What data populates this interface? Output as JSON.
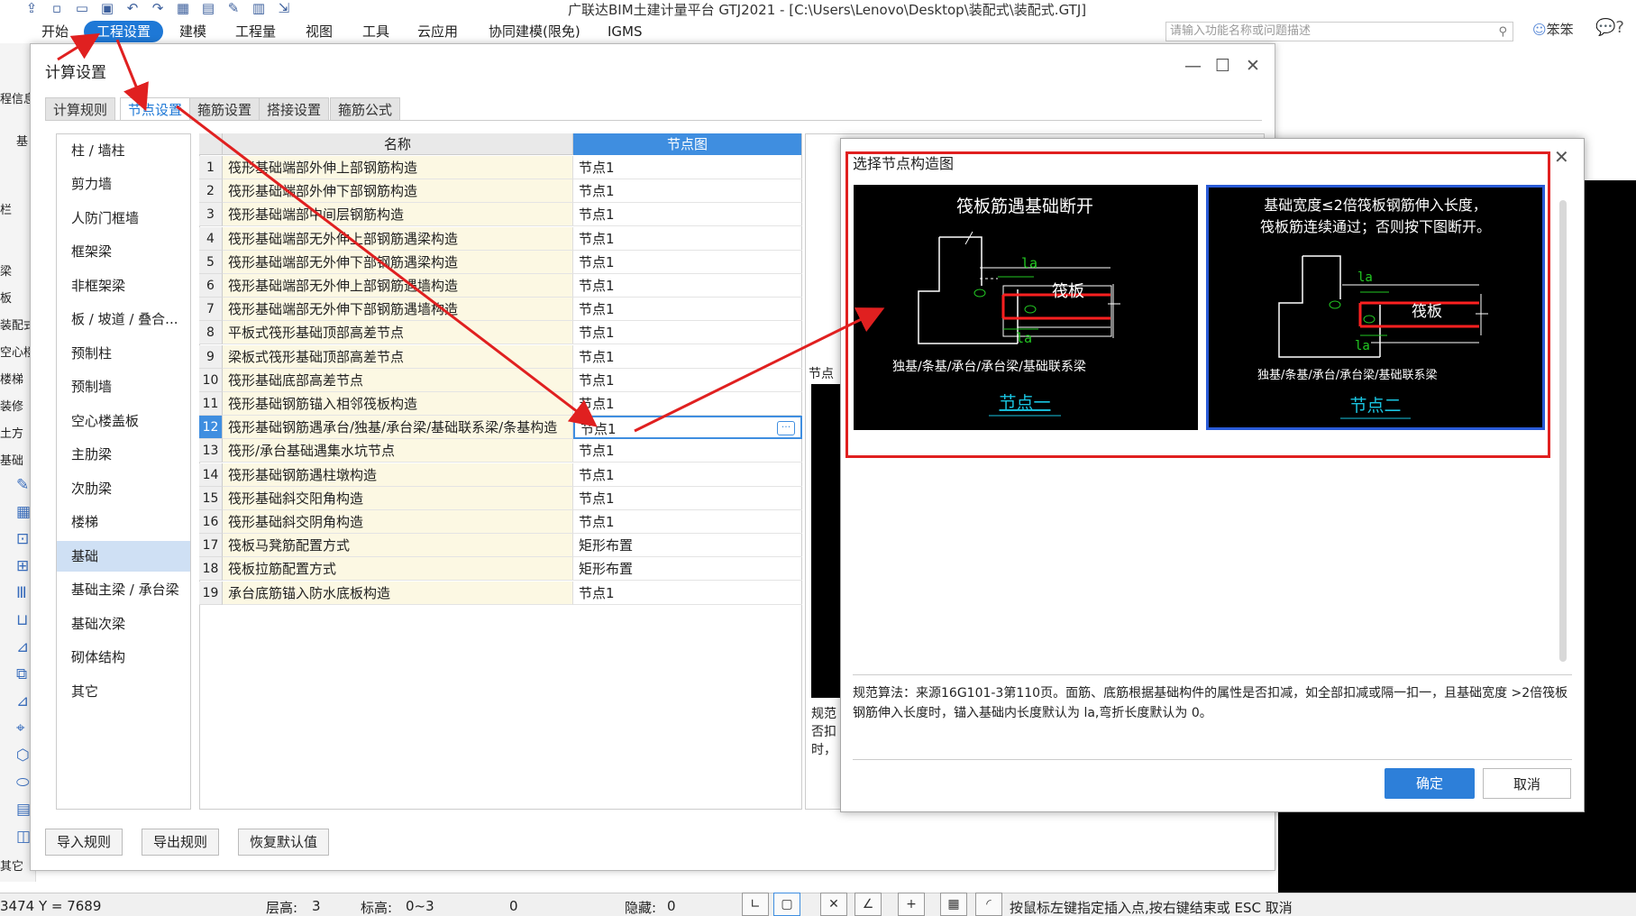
{
  "app": {
    "title": "广联达BIM土建计量平台 GTJ2021 - [C:\\Users\\Lenovo\\Desktop\\装配式\\装配式.GTJ]",
    "menu": [
      "开始",
      "工程设置",
      "建模",
      "工程量",
      "视图",
      "工具",
      "云应用",
      "协同建模(限免)",
      "IGMS"
    ],
    "search_placeholder": "请输入功能名称或问题描述",
    "user": "笨笨",
    "help_label": "?"
  },
  "left_strip": {
    "labels": [
      "程信息",
      "基",
      "梁",
      "板",
      "装配式",
      "空心楼",
      "楼梯",
      "装修",
      "土方",
      "基础",
      "其它"
    ],
    "top_label": "栏",
    "coordinate": "3474 Y = 7689"
  },
  "calc_dialog": {
    "title": "计算设置",
    "window_buttons": {
      "minimize": "—",
      "maximize": "☐",
      "close": "✕"
    },
    "tabs": [
      "计算规则",
      "节点设置",
      "箍筋设置",
      "搭接设置",
      "箍筋公式"
    ],
    "active_tab": 1,
    "categories": [
      "柱 / 墙柱",
      "剪力墙",
      "人防门框墙",
      "框架梁",
      "非框架梁",
      "板 / 坡道 / 叠合...",
      "预制柱",
      "预制墙",
      "空心楼盖板",
      "主肋梁",
      "次肋梁",
      "楼梯",
      "基础",
      "基础主梁 / 承台梁",
      "基础次梁",
      "砌体结构",
      "其它"
    ],
    "selected_category": 12,
    "columns": {
      "name": "名称",
      "node": "节点图"
    },
    "rows": [
      {
        "n": "1",
        "name": "筏形基础端部外伸上部钢筋构造",
        "value": "节点1"
      },
      {
        "n": "2",
        "name": "筏形基础端部外伸下部钢筋构造",
        "value": "节点1"
      },
      {
        "n": "3",
        "name": "筏形基础端部中间层钢筋构造",
        "value": "节点1"
      },
      {
        "n": "4",
        "name": "筏形基础端部无外伸上部钢筋遇梁构造",
        "value": "节点1"
      },
      {
        "n": "5",
        "name": "筏形基础端部无外伸下部钢筋遇梁构造",
        "value": "节点1"
      },
      {
        "n": "6",
        "name": "筏形基础端部无外伸上部钢筋遇墙构造",
        "value": "节点1"
      },
      {
        "n": "7",
        "name": "筏形基础端部无外伸下部钢筋遇墙构造",
        "value": "节点1"
      },
      {
        "n": "8",
        "name": "平板式筏形基础顶部高差节点",
        "value": "节点1"
      },
      {
        "n": "9",
        "name": "梁板式筏形基础顶部高差节点",
        "value": "节点1"
      },
      {
        "n": "10",
        "name": "筏形基础底部高差节点",
        "value": "节点1"
      },
      {
        "n": "11",
        "name": "筏形基础钢筋锚入相邻筏板构造",
        "value": "节点1"
      },
      {
        "n": "12",
        "name": "筏形基础钢筋遇承台/独基/承台梁/基础联系梁/条基构造",
        "value": "节点1"
      },
      {
        "n": "13",
        "name": "筏形/承台基础遇集水坑节点",
        "value": "节点1"
      },
      {
        "n": "14",
        "name": "筏形基础钢筋遇柱墩构造",
        "value": "节点1"
      },
      {
        "n": "15",
        "name": "筏形基础斜交阳角构造",
        "value": "节点1"
      },
      {
        "n": "16",
        "name": "筏形基础斜交阴角构造",
        "value": "节点1"
      },
      {
        "n": "17",
        "name": "筏板马凳筋配置方式",
        "value": "矩形布置"
      },
      {
        "n": "18",
        "name": "筏板拉筋配置方式",
        "value": "矩形布置"
      },
      {
        "n": "19",
        "name": "承台底筋锚入防水底板构造",
        "value": "节点1"
      }
    ],
    "selected_row": 11,
    "ellipsis": "···",
    "mid_label": "节点",
    "mid_text": "规范否扣时，",
    "bottom_buttons": [
      "导入规则",
      "导出规则",
      "恢复默认值"
    ]
  },
  "node_dialog": {
    "title": "选择节点构造图",
    "close": "✕",
    "option1": {
      "heading": "筏板筋遇基础断开",
      "dim1": "la",
      "dim2": "la",
      "plate": "筏板",
      "caption": "独基/条基/承台/承台梁/基础联系梁",
      "link": "节点一"
    },
    "option2": {
      "heading1": "基础宽度≤2倍筏板钢筋伸入长度，",
      "heading2": "筏板筋连续通过；否则按下图断开。",
      "dim1": "la",
      "dim2": "la",
      "plate": "筏板",
      "caption": "独基/条基/承台/承台梁/基础联系梁",
      "link": "节点二"
    },
    "selected_option": 2,
    "description": "规范算法：来源16G101-3第110页。面筋、底筋根据基础构件的属性是否扣减，如全部扣减或隔一扣一，且基础宽度 >2倍筏板钢筋伸入长度时，锚入基础内长度默认为 la,弯折长度默认为 0。",
    "ok": "确定",
    "cancel": "取消"
  },
  "status": {
    "floor_height_label": "层高:",
    "floor_height": "3",
    "elevation_label": "标高:",
    "elevation": "0~3",
    "zero": "0",
    "hidden_label": "隐藏:",
    "hidden": "0",
    "hint": "按鼠标左键指定插入点,按右键结束或 ESC 取消"
  },
  "colors": {
    "accent": "#1e78d6",
    "highlight_header": "#3f8ee0",
    "annotation_red": "#e02020",
    "name_cell_bg": "#fcf8e3",
    "cad_red": "#ff2020",
    "cad_green": "#22c822",
    "cad_link": "#19c4e0"
  }
}
